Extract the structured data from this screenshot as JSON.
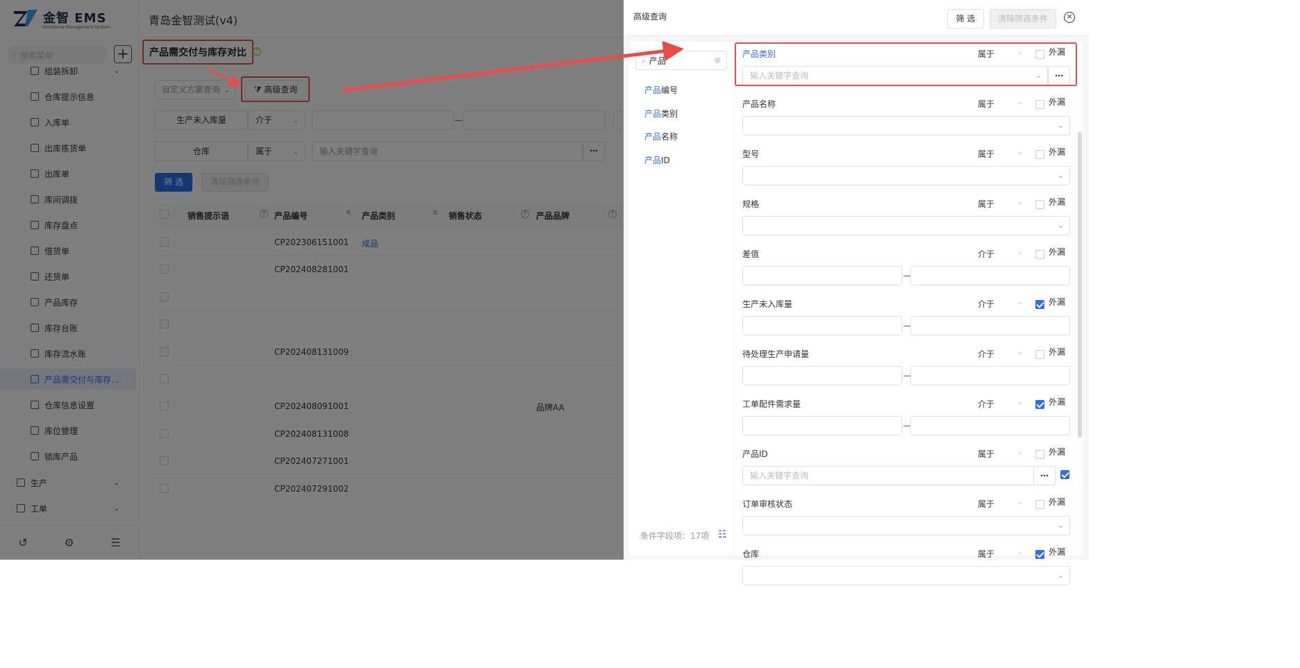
{
  "app": {
    "logo_title": "金智 EMS",
    "logo_sub": "Enterprise Management System",
    "title": "青岛金智测试(v4)"
  },
  "sidebar": {
    "search_placeholder": "搜索菜单",
    "items": [
      {
        "label": "组装拆卸"
      },
      {
        "label": "仓库提示信息"
      },
      {
        "label": "入库单"
      },
      {
        "label": "出库拣货单"
      },
      {
        "label": "出库单"
      },
      {
        "label": "库间调拨"
      },
      {
        "label": "库存盘点"
      },
      {
        "label": "借货单"
      },
      {
        "label": "还货单"
      },
      {
        "label": "产品库存"
      },
      {
        "label": "库存台账"
      },
      {
        "label": "库存流水账"
      },
      {
        "label": "产品需交付与库存..."
      },
      {
        "label": "仓库信息设置"
      },
      {
        "label": "库位管理"
      },
      {
        "label": "锁库产品"
      }
    ],
    "groups": [
      {
        "label": "生产"
      },
      {
        "label": "工单"
      }
    ]
  },
  "main": {
    "page_title": "产品需交付与库存对比",
    "custom_scheme": "自定义方案查询",
    "adv_query": "高级查询",
    "filters": [
      {
        "label": "生产未入库量",
        "op": "介于"
      },
      {
        "label": "仓库",
        "op": "属于",
        "placeholder": "输入关键字查询"
      }
    ],
    "filter_btn": "筛 选",
    "clear_btn": "清除筛选条件",
    "columns": [
      "销售提示语",
      "产品编号",
      "产品类别",
      "销售状态",
      "产品品牌"
    ],
    "rows": [
      {
        "code": "CP202306151001",
        "category": "成品",
        "brand": ""
      },
      {
        "code": "CP202408281001",
        "category": "",
        "brand": ""
      },
      {
        "code": "",
        "category": "",
        "brand": ""
      },
      {
        "code": "",
        "category": "",
        "brand": ""
      },
      {
        "code": "CP202408131009",
        "category": "",
        "brand": ""
      },
      {
        "code": "",
        "category": "",
        "brand": ""
      },
      {
        "code": "CP202408091001",
        "category": "",
        "brand": "品牌AA"
      },
      {
        "code": "CP202408131008",
        "category": "",
        "brand": ""
      },
      {
        "code": "CP202407271001",
        "category": "",
        "brand": ""
      },
      {
        "code": "CP202407291002",
        "category": "",
        "brand": ""
      }
    ]
  },
  "drawer": {
    "title": "高级查询",
    "filter_btn": "筛 选",
    "clear_btn": "清除筛选条件",
    "field_search": "产品",
    "fields": [
      {
        "hl": "产品",
        "rest": "编号"
      },
      {
        "hl": "产品",
        "rest": "类别"
      },
      {
        "hl": "产品",
        "rest": "名称"
      },
      {
        "hl": "产品",
        "rest": "ID"
      }
    ],
    "count": "条件字段项：17项",
    "conditions": [
      {
        "label": "产品类别",
        "op": "属于",
        "missing": "外漏",
        "checked": false,
        "placeholder": "输入关键字查询"
      },
      {
        "label": "产品名称",
        "op": "属于",
        "missing": "外漏",
        "checked": false
      },
      {
        "label": "型号",
        "op": "属于",
        "missing": "外漏",
        "checked": false
      },
      {
        "label": "规格",
        "op": "属于",
        "missing": "外漏",
        "checked": false
      },
      {
        "label": "差值",
        "op": "介于",
        "missing": "外漏",
        "checked": false
      },
      {
        "label": "生产未入库量",
        "op": "介于",
        "missing": "外漏",
        "checked": true
      },
      {
        "label": "待处理生产申请量",
        "op": "介于",
        "missing": "外漏",
        "checked": false
      },
      {
        "label": "工单配件需求量",
        "op": "介于",
        "missing": "外漏",
        "checked": true
      },
      {
        "label": "产品ID",
        "op": "属于",
        "missing": "外漏",
        "checked": false,
        "placeholder": "输入关键字查询"
      },
      {
        "label": "订单审核状态",
        "op": "属于",
        "missing": "外漏",
        "checked": false
      },
      {
        "label": "仓库",
        "op": "属于",
        "missing": "外漏",
        "checked": true
      }
    ]
  },
  "colors": {
    "accent": "#2f6ee8",
    "annotation": "#e94a4a"
  }
}
